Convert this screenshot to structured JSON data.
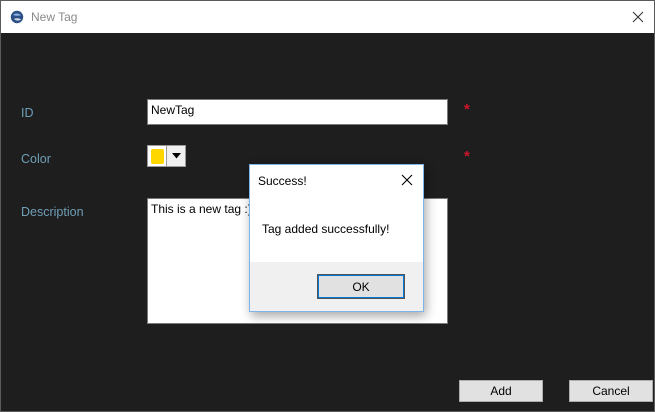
{
  "window": {
    "title": "New Tag",
    "icon": "app-globe-icon"
  },
  "form": {
    "id_label": "ID",
    "id_value": "NewTag",
    "color_label": "Color",
    "color_value": "#ffd700",
    "description_label": "Description",
    "description_value": "This is a new tag :)",
    "required_marker": "*"
  },
  "buttons": {
    "add_label": "Add",
    "cancel_label": "Cancel"
  },
  "dialog": {
    "title": "Success!",
    "message": "Tag added successfully!",
    "ok_label": "OK"
  },
  "colors": {
    "background": "#1e1e1e",
    "label": "#6f9fb8",
    "required": "#d0152b",
    "dialog_border": "#7eb4ea"
  }
}
